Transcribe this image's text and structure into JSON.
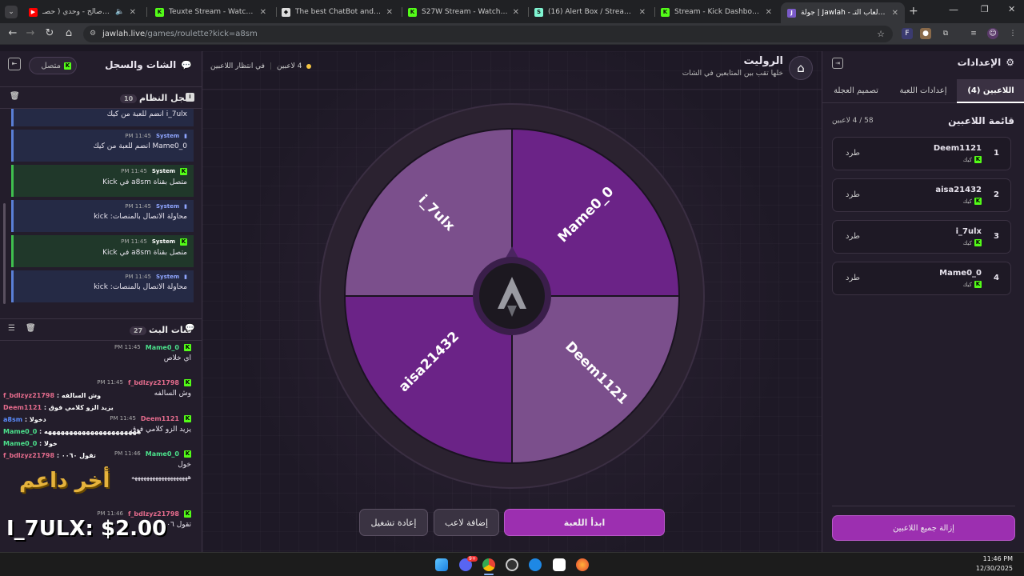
{
  "browser": {
    "tabs": [
      {
        "title": "عباس بن صالح - وحدي ( حصـ",
        "audio": "🔈",
        "favicon": "youtube",
        "color": "#ff0000"
      },
      {
        "title": "Teuxte Stream - Watch Live on",
        "favicon": "kick",
        "color": "#53fc18"
      },
      {
        "title": "The best ChatBot and Widgets",
        "favicon": "streamelements",
        "color": "#ddd"
      },
      {
        "title": "S27W Stream - Watch Live on",
        "favicon": "kick",
        "color": "#53fc18"
      },
      {
        "title": "(16) Alert Box / Streamlabs",
        "favicon": "streamlabs",
        "color": "#80f5d2"
      },
      {
        "title": "Stream - Kick Dashboard",
        "favicon": "kick",
        "color": "#53fc18"
      },
      {
        "title": "جولة | Jawlah - منصة الألعاب التـ",
        "favicon": "jawlah",
        "color": "#c0a0ff",
        "active": true
      }
    ],
    "url_host": "jawlah.live",
    "url_path": "/games/roulette?kick=a8sm",
    "new_tab_label": "+"
  },
  "left": {
    "title": "الشات والسجل",
    "status": "متصل",
    "system_log": {
      "title": "سجل النظام",
      "count": "10",
      "entries": [
        {
          "user": "",
          "time": "",
          "text": "i_7ulx انضم للعبة من كيك",
          "style": "blue"
        },
        {
          "user": "System",
          "time": "11:45 PM",
          "text": "Mame0_0 انضم للعبة من كيك",
          "style": "blue"
        },
        {
          "user": "System",
          "time": "11:45 PM",
          "text": "متصل بقناة a8sm في Kick",
          "style": "green"
        },
        {
          "user": "System",
          "time": "11:45 PM",
          "text": "محاولة الاتصال بالمنصات: kick",
          "style": "blue"
        },
        {
          "user": "System",
          "time": "11:45 PM",
          "text": "متصل بقناة a8sm في Kick",
          "style": "green"
        },
        {
          "user": "System",
          "time": "11:45 PM",
          "text": "محاولة الاتصال بالمنصات: kick",
          "style": "blue"
        }
      ]
    },
    "stream_chat": {
      "title": "شات البث",
      "count": "27",
      "messages": [
        {
          "user": "Mame0_0",
          "time": "11:45 PM",
          "text": "اي خلاص",
          "color": "green"
        },
        {
          "user": "f_bdlzyz21798",
          "time": "11:45 PM",
          "text": "وش السالفه",
          "color": "pink"
        },
        {
          "user": "Deem1121",
          "time": "11:45 PM",
          "text": "يزيد الزو كلامي فوق",
          "color": "pink"
        },
        {
          "user": "Mame0_0",
          "time": "11:46 PM",
          "text": "خول",
          "color": "green"
        },
        {
          "user": "",
          "time": "",
          "text": "هههههههههههههههههههه",
          "color": "green"
        },
        {
          "user": "f_bdlzyz21798",
          "time": "11:46 PM",
          "text": "تقول ٠٠٦",
          "color": "pink"
        }
      ]
    },
    "overlay_chat": [
      {
        "user": "f_bdlzyz21798",
        "text": "وش السالفه",
        "color": "#e46b8c"
      },
      {
        "user": "Deem1121",
        "text": "يزيد الزو كلامي فوق",
        "color": "#e46b8c"
      },
      {
        "user": "a8sm",
        "text": "دخولا",
        "color": "#5b8dff"
      },
      {
        "user": "Mame0_0",
        "text": "ههههههههههههههههههههههه",
        "color": "#4be08b"
      },
      {
        "user": "Mame0_0",
        "text": "خولا",
        "color": "#4be08b"
      },
      {
        "user": "f_bdlzyz21798",
        "text": "تقول ٠٠٦٠",
        "color": "#e46b8c"
      }
    ],
    "overlay_supporter_label": "أخر داعم",
    "overlay_supporter_value": "I_7ULX: $2.00"
  },
  "center": {
    "title": "الروليت",
    "subtitle": "خلها تقب بين المتابعين في الشات",
    "players_status": "4 لاعبين",
    "waiting_status": "في انتظار اللاعبين",
    "wheel_segments": [
      "Mame0_0",
      "Deem1121",
      "aisa21432",
      "i_7ulx"
    ],
    "start_button": "ابدأ اللعبة",
    "add_player_button": "إضافة لاعب",
    "restart_button": "إعادة تشغيل"
  },
  "right": {
    "title": "الإعدادات",
    "tabs": [
      "اللاعبين (4)",
      "إعدادات اللعبة",
      "تصميم العجلة"
    ],
    "list_title": "قائمة اللاعبين",
    "list_count": "58 / 4 لاعبين",
    "kick_label": "كيك",
    "kick_action": "طرد",
    "players": [
      {
        "rank": "1",
        "name": "Deem1121"
      },
      {
        "rank": "2",
        "name": "aisa21432"
      },
      {
        "rank": "3",
        "name": "i_7ulx"
      },
      {
        "rank": "4",
        "name": "Mame0_0"
      }
    ],
    "remove_all_button": "إزالة جميع اللاعبين"
  },
  "taskbar": {
    "time": "11:46 PM",
    "date": "12/30/2025",
    "badge": "9+"
  }
}
